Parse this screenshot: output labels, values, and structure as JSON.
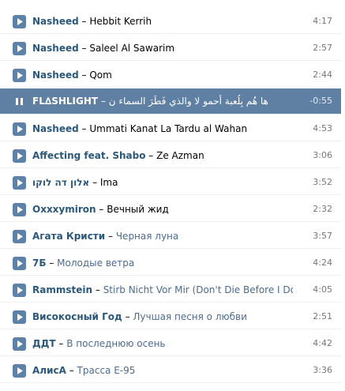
{
  "tracks": [
    {
      "artist": "Nasheed",
      "separator": "–",
      "title": "Hebbit Kerrih",
      "duration": "4:17",
      "state": "paused",
      "cyrillic": false
    },
    {
      "artist": "Nasheed",
      "separator": "–",
      "title": "Saleel Al Sawarim",
      "duration": "2:57",
      "state": "paused",
      "cyrillic": false
    },
    {
      "artist": "Nasheed",
      "separator": "–",
      "title": "Qom",
      "duration": "2:44",
      "state": "paused",
      "cyrillic": false
    },
    {
      "artist": "FL∆SHLIGHT",
      "separator": "–",
      "title": "ها هُم بِلُعبة أحمو لا والذي فَطَرَ السماء ن",
      "duration": "-0:55",
      "state": "playing",
      "cyrillic": false
    },
    {
      "artist": "Nasheed",
      "separator": "–",
      "title": "Ummati Kanat La Tardu al Wahan",
      "duration": "4:53",
      "state": "paused",
      "cyrillic": false
    },
    {
      "artist": "Affecting feat. Shabo",
      "separator": "–",
      "title": "Ze Azman",
      "duration": "3:06",
      "state": "paused",
      "cyrillic": false
    },
    {
      "artist": "אלון דה לוקו",
      "separator": "–",
      "title": "Ima",
      "duration": "3:52",
      "state": "paused",
      "cyrillic": false
    },
    {
      "artist": "Oxxxymiron",
      "separator": "–",
      "title": "Вечный жид",
      "duration": "2:32",
      "state": "paused",
      "cyrillic": false
    },
    {
      "artist": "Агата Кристи",
      "separator": "–",
      "title": "Черная луна",
      "duration": "3:57",
      "state": "paused",
      "cyrillic": true
    },
    {
      "artist": "7Б",
      "separator": "–",
      "title": "Молодые ветра",
      "duration": "4:24",
      "state": "paused",
      "cyrillic": true
    },
    {
      "artist": "Rammstein",
      "separator": "–",
      "title": "Stirb Nicht Vor Mir (Don't Die Before I Do)",
      "duration": "4:05",
      "state": "paused",
      "cyrillic": true
    },
    {
      "artist": "Високосный Год",
      "separator": "–",
      "title": "Лучшая песня о любви",
      "duration": "2:51",
      "state": "paused",
      "cyrillic": true
    },
    {
      "artist": "ДДТ",
      "separator": "–",
      "title": "В последнюю осень",
      "duration": "4:42",
      "state": "paused",
      "cyrillic": true
    },
    {
      "artist": "АлисА",
      "separator": "–",
      "title": "Трасса Е-95",
      "duration": "3:36",
      "state": "paused",
      "cyrillic": true
    }
  ],
  "icons": {
    "play": "play-icon",
    "pause": "pause-icon"
  },
  "colors": {
    "accent": "#5e81a8",
    "artist": "#2b587a",
    "active_row": "#5f7fa3",
    "duration": "#777777"
  }
}
